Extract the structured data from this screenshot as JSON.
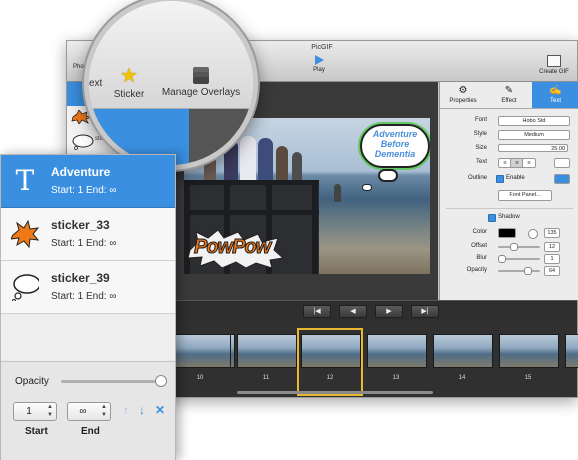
{
  "window": {
    "title": "PicGIF",
    "toolbar": {
      "photos_label": "Pho",
      "play_label": "Play",
      "create_label": "Create GIF"
    }
  },
  "magnifier": {
    "partial_text": "ext",
    "sticker_label": "Sticker",
    "overlays_label": "Manage Overlays"
  },
  "left_strip": {
    "partial_label": "stic"
  },
  "canvas": {
    "cloud_text": "Adventure Before Dementia",
    "boom_text": "PowPow"
  },
  "right_panel": {
    "tabs": [
      {
        "label": "Properties",
        "icon": "gear-icon"
      },
      {
        "label": "Effect",
        "icon": "wand-icon"
      },
      {
        "label": "Text",
        "icon": "text-edit-icon",
        "active": true
      }
    ],
    "font_label": "Font",
    "font_value": "Hobo Std",
    "style_label": "Style",
    "style_value": "Medium",
    "size_label": "Size",
    "size_value": "25.00",
    "text_label": "Text",
    "outline_label": "Outline",
    "enable_label": "Enable",
    "font_panel_label": "Font Panel...",
    "shadow_label": "Shadow",
    "color_label": "Color",
    "color_value": "135",
    "offset_label": "Offset",
    "offset_value": "12",
    "blur_label": "Blur",
    "blur_value": "1",
    "opacity_label": "Opacity",
    "opacity_value": "64"
  },
  "controls": {
    "first": "|◀",
    "prev": "◀",
    "next": "▶",
    "last": "▶|"
  },
  "filmstrip": {
    "frame_numbers": [
      "10",
      "11",
      "12",
      "13",
      "14",
      "15"
    ],
    "selected_frame": "12"
  },
  "layers": {
    "items": [
      {
        "name": "Adventure",
        "sub": "Start: 1 End: ∞",
        "icon": "text-layer-icon",
        "selected": true
      },
      {
        "name": "sticker_33",
        "sub": "Start: 1 End: ∞",
        "icon": "explosion-sticker-icon"
      },
      {
        "name": "sticker_39",
        "sub": "Start: 1 End: ∞",
        "icon": "cloud-sticker-icon"
      }
    ],
    "opacity_label": "Opacity",
    "start_value": "1",
    "end_value": "∞",
    "start_label": "Start",
    "end_label": "End"
  },
  "colors": {
    "accent_blue": "#3a8fe0",
    "outline_color": "#3a8fe0",
    "shadow_color": "#000000",
    "sticker_orange": "#f07a18",
    "film_selected": "#e8b830"
  }
}
